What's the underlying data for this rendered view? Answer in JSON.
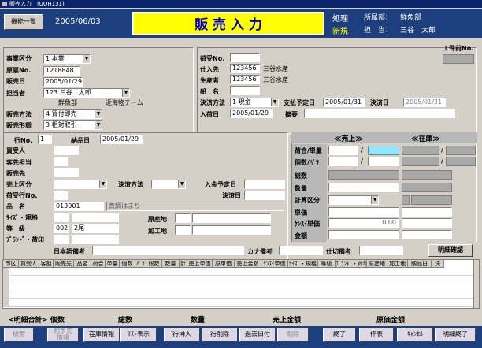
{
  "window_title": "販売入力　(UOH131)",
  "header": {
    "menu_button": "機能一覧",
    "date": "2005/06/03",
    "screen_title": "販 売 入 力",
    "mode_label": "処理",
    "mode_value": "新規",
    "dept_label": "所属部：",
    "dept_value": "鮮魚部",
    "person_label": "担　当：",
    "person_value": "三谷　太郎"
  },
  "top_right": {
    "prev_label": "１件前No."
  },
  "left": {
    "business_type_label": "事業区分",
    "business_type_value": "1 本業",
    "ticket_label": "原票No.",
    "ticket_value": "1218848",
    "sale_date_label": "販売日",
    "sale_date_value": "2005/01/29",
    "staff_label": "担当者",
    "staff_value": "123 三谷　太郎",
    "staff_dept": "鮮魚部",
    "staff_team": "近海物チーム",
    "method_label": "販売方法",
    "method_value": "4 買付即売",
    "form_label": "販売形態",
    "form_value": "3 相対取引"
  },
  "middle": {
    "cargo_label": "荷受No.",
    "cargo_value": "",
    "buy_from_label": "仕入先",
    "buy_from_code": "123456",
    "buy_from_name": "三谷水産",
    "producer_label": "生産者",
    "producer_code": "123456",
    "producer_name": "三谷水産",
    "ship_label": "船　名",
    "ship_value": "",
    "settle_label": "決済方法",
    "settle_value": "1 現金",
    "pay_date_label": "支払予定日",
    "pay_date_value": "2005/01/31",
    "settle_date_label": "決済日",
    "settle_date_value": "2005/01/31",
    "arrive_label": "入荷日",
    "arrive_value": "2005/01/29",
    "summary_label": "摘要",
    "summary_value": ""
  },
  "detail": {
    "row_label": "行No.",
    "row_value": "1",
    "deliver_label": "納品日",
    "deliver_value": "2005/01/29",
    "buyer_label": "買受人",
    "customer_staff_label": "客先担当",
    "sell_to_label": "販売先",
    "sale_type_label": "売上区分",
    "settle_method_label": "決済方法",
    "deposit_label": "入金予定日",
    "cargo_row_label": "荷受行No.",
    "settle_date_label": "決済日",
    "item_label": "品　名",
    "item_code": "013001",
    "item_name": "真鯛はまち",
    "size_label": "ｻｲｽﾞ・規格",
    "grade_label": "等　級",
    "grade_code": "002",
    "grade_name": "2尾",
    "brand_label": "ﾌﾞﾗﾝﾄﾞ・荷印",
    "origin_label": "原産地",
    "process_label": "加工地",
    "jp_note_label": "日本語備考",
    "kana_note_label": "カナ備考",
    "purchase_note_label": "仕切備考",
    "detail_confirm": "明細確認"
  },
  "right_panel": {
    "sales_header": "≪売上≫",
    "stock_header": "≪在庫≫",
    "lot_label": "荷合/単量",
    "count_label": "個数/ﾊﾞﾗ",
    "total_label": "総数",
    "qty_label": "数量",
    "calc_label": "計算区分",
    "unit_label": "単価",
    "tax_unit_label": "ｹﾝｽｲ単価",
    "tax_unit_value": "0.00",
    "amount_label": "金額"
  },
  "grid": {
    "columns": [
      "市区",
      "買受人",
      "客担",
      "販売先",
      "品名",
      "荷合",
      "単量",
      "個数",
      "ﾊﾞﾗ",
      "総数",
      "数量",
      "計",
      "売上単価",
      "原単価",
      "売上金額",
      "ｹﾝｽｲ単価",
      "ｻｲｽﾞ・規格",
      "等級",
      "ﾌﾞﾗﾝﾄﾞ・荷印",
      "原産地",
      "加工地",
      "納品日",
      "決"
    ]
  },
  "summary": {
    "detail_total": "<明細合計>",
    "count": "個数",
    "total": "総数",
    "qty": "数量",
    "sales": "売上金額",
    "cost": "原価金額"
  },
  "footer": {
    "buttons": [
      "検索",
      "相手先\n情報",
      "在庫情報",
      "ﾘｽﾄ表示",
      "行挿入",
      "行削除",
      "過去日付",
      "削除",
      "終了",
      "作表",
      "ｷｬﾝｾﾙ",
      "明細終了"
    ]
  },
  "colors": {
    "header_bg": "#1e3f7d",
    "title_bg": "#ffff00",
    "title_fg": "#0000cc",
    "mode_fg": "#ffff00",
    "cyan": "#8fe6ff"
  }
}
